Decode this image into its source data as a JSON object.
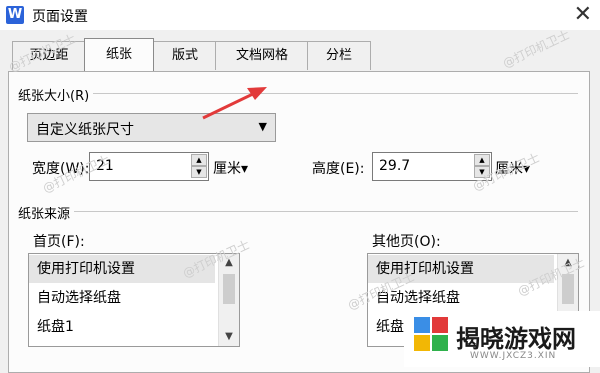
{
  "window": {
    "app_icon_letter": "W",
    "title": "页面设置",
    "close_glyph": "✕"
  },
  "tabs": [
    "页边距",
    "纸张",
    "版式",
    "文档网格",
    "分栏"
  ],
  "paper_size": {
    "label": "纸张大小(R)",
    "selected": "自定义纸张尺寸",
    "arrow": "▼"
  },
  "width": {
    "label": "宽度(W):",
    "value": "21",
    "unit": "厘米▾"
  },
  "height": {
    "label": "高度(E):",
    "value": "29.7",
    "unit": "厘米▾"
  },
  "paper_source": {
    "label": "纸张来源"
  },
  "first_page": {
    "label": "首页(F):",
    "items": [
      "使用打印机设置",
      "自动选择纸盘",
      "纸盘1"
    ]
  },
  "other_pages": {
    "label": "其他页(O):",
    "items": [
      "使用打印机设置",
      "自动选择纸盘",
      "纸盘1"
    ]
  },
  "spin_glyphs": {
    "up": "▲",
    "down": "▼"
  },
  "watermark_text": "@打印机卫士",
  "logo": {
    "name": "揭晓游戏网",
    "url": "WWW.JXCZ3.XIN"
  },
  "colors": {
    "accent": "#2b63d9",
    "arrow": "#e23a3a",
    "selection": "#e5e5e5"
  }
}
